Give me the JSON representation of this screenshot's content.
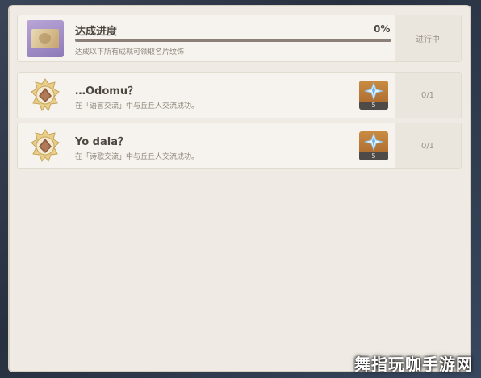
{
  "summary": {
    "title": "达成进度",
    "subtitle": "达成以下所有成就可领取名片纹饰",
    "percent_label": "0%",
    "progress": 0,
    "status": "进行中"
  },
  "achievements": [
    {
      "title": "…Odomu？",
      "description": "在「语言交流」中与丘丘人交流成功。",
      "reward_icon": "primogem-icon",
      "reward_count": "5",
      "progress": "0/1"
    },
    {
      "title": "Yo dala？",
      "description": "在「诗歌交流」中与丘丘人交流成功。",
      "reward_icon": "primogem-icon",
      "reward_count": "5",
      "progress": "0/1"
    }
  ],
  "watermark": "舞指玩咖手游网",
  "colors": {
    "panel": "#efebe4",
    "card": "#f6f3ee",
    "accent_gold": "#d3b87a",
    "reward_bg": "#c98c43",
    "thumb_purple": "#9d88c4"
  }
}
